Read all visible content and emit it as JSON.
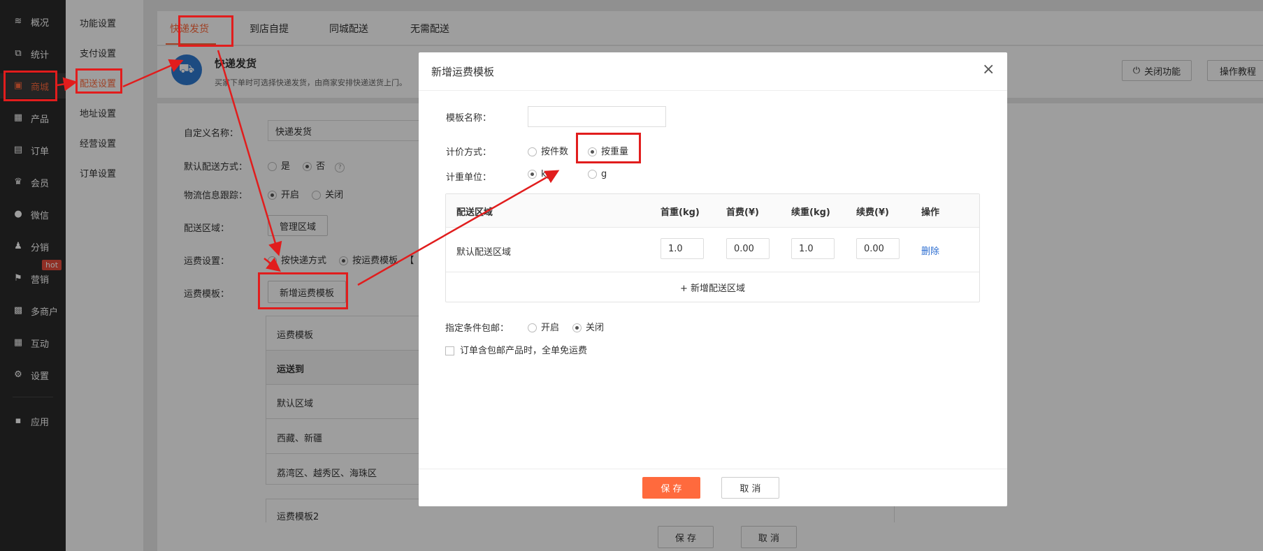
{
  "nav": {
    "items": [
      {
        "label": "概况",
        "icon": "layers-icon",
        "glyph": "≋"
      },
      {
        "label": "统计",
        "icon": "chart-icon",
        "glyph": "⧉"
      },
      {
        "label": "商城",
        "icon": "shop-icon",
        "glyph": "▣"
      },
      {
        "label": "产品",
        "icon": "grid-icon",
        "glyph": "▦"
      },
      {
        "label": "订单",
        "icon": "order-icon",
        "glyph": "▤"
      },
      {
        "label": "会员",
        "icon": "crown-icon",
        "glyph": "♛"
      },
      {
        "label": "微信",
        "icon": "wechat-icon",
        "glyph": "●"
      },
      {
        "label": "分销",
        "icon": "users-icon",
        "glyph": "♟"
      },
      {
        "label": "营销",
        "icon": "flag-icon",
        "glyph": "⚑"
      },
      {
        "label": "多商户",
        "icon": "store-icon",
        "glyph": "▩"
      },
      {
        "label": "互动",
        "icon": "interact-icon",
        "glyph": "▦"
      },
      {
        "label": "设置",
        "icon": "gear-icon",
        "glyph": "⚙"
      },
      {
        "label": "应用",
        "icon": "apps-icon",
        "glyph": "▪"
      }
    ],
    "hot_badge": "hot"
  },
  "subnav": {
    "items": [
      "功能设置",
      "支付设置",
      "配送设置",
      "地址设置",
      "经营设置",
      "订单设置"
    ]
  },
  "tabs": [
    "快递发货",
    "到店自提",
    "同城配送",
    "无需配送"
  ],
  "header": {
    "title": "快递发货",
    "desc": "买家下单时可选择快递发货，由商家安排快递送货上门。",
    "close_btn": "关闭功能",
    "tutorial_btn": "操作教程"
  },
  "form": {
    "custom_name_label": "自定义名称：",
    "custom_name_value": "快递发货",
    "default_method_label": "默认配送方式：",
    "yes": "是",
    "no": "否",
    "help": "?",
    "tracking_label": "物流信息跟踪：",
    "on": "开启",
    "off": "关闭",
    "area_label": "配送区域：",
    "manage_area_btn": "管理区域",
    "fee_setting_label": "运费设置：",
    "by_express": "按快递方式",
    "by_template": "按运费模板",
    "bracket": "【",
    "template_label": "运费模板：",
    "add_template_btn": "新增运费模板",
    "template_table": {
      "title": "运费模板",
      "header": "运送到",
      "rows": [
        "默认区域",
        "西藏、新疆",
        "荔湾区、越秀区、海珠区"
      ],
      "next": "运费模板2"
    },
    "save": "保 存",
    "cancel": "取 消"
  },
  "modal": {
    "title": "新增运费模板",
    "name_label": "模板名称：",
    "name_value": "",
    "pricing_label": "计价方式：",
    "by_count": "按件数",
    "by_weight": "按重量",
    "unit_label": "计重单位：",
    "unit_kg": "kg",
    "unit_g": "g",
    "table_headers": [
      "配送区域",
      "首重(kg)",
      "首费(¥)",
      "续重(kg)",
      "续费(¥)",
      "操作"
    ],
    "row": {
      "area": "默认配送区域",
      "first_weight": "1.0",
      "first_fee": "0.00",
      "extra_weight": "1.0",
      "extra_fee": "0.00",
      "delete": "删除"
    },
    "add_area": "+ 新增配送区域",
    "free_label": "指定条件包邮：",
    "free_on": "开启",
    "free_off": "关闭",
    "free_order_text": "订单含包邮产品时，全单免运费",
    "save": "保 存",
    "cancel": "取 消"
  },
  "colors": {
    "accent": "#ff6a3d",
    "nav_bg": "#2b2b2b",
    "annotation_red": "#e11d1d",
    "link": "#2d6ed1"
  }
}
